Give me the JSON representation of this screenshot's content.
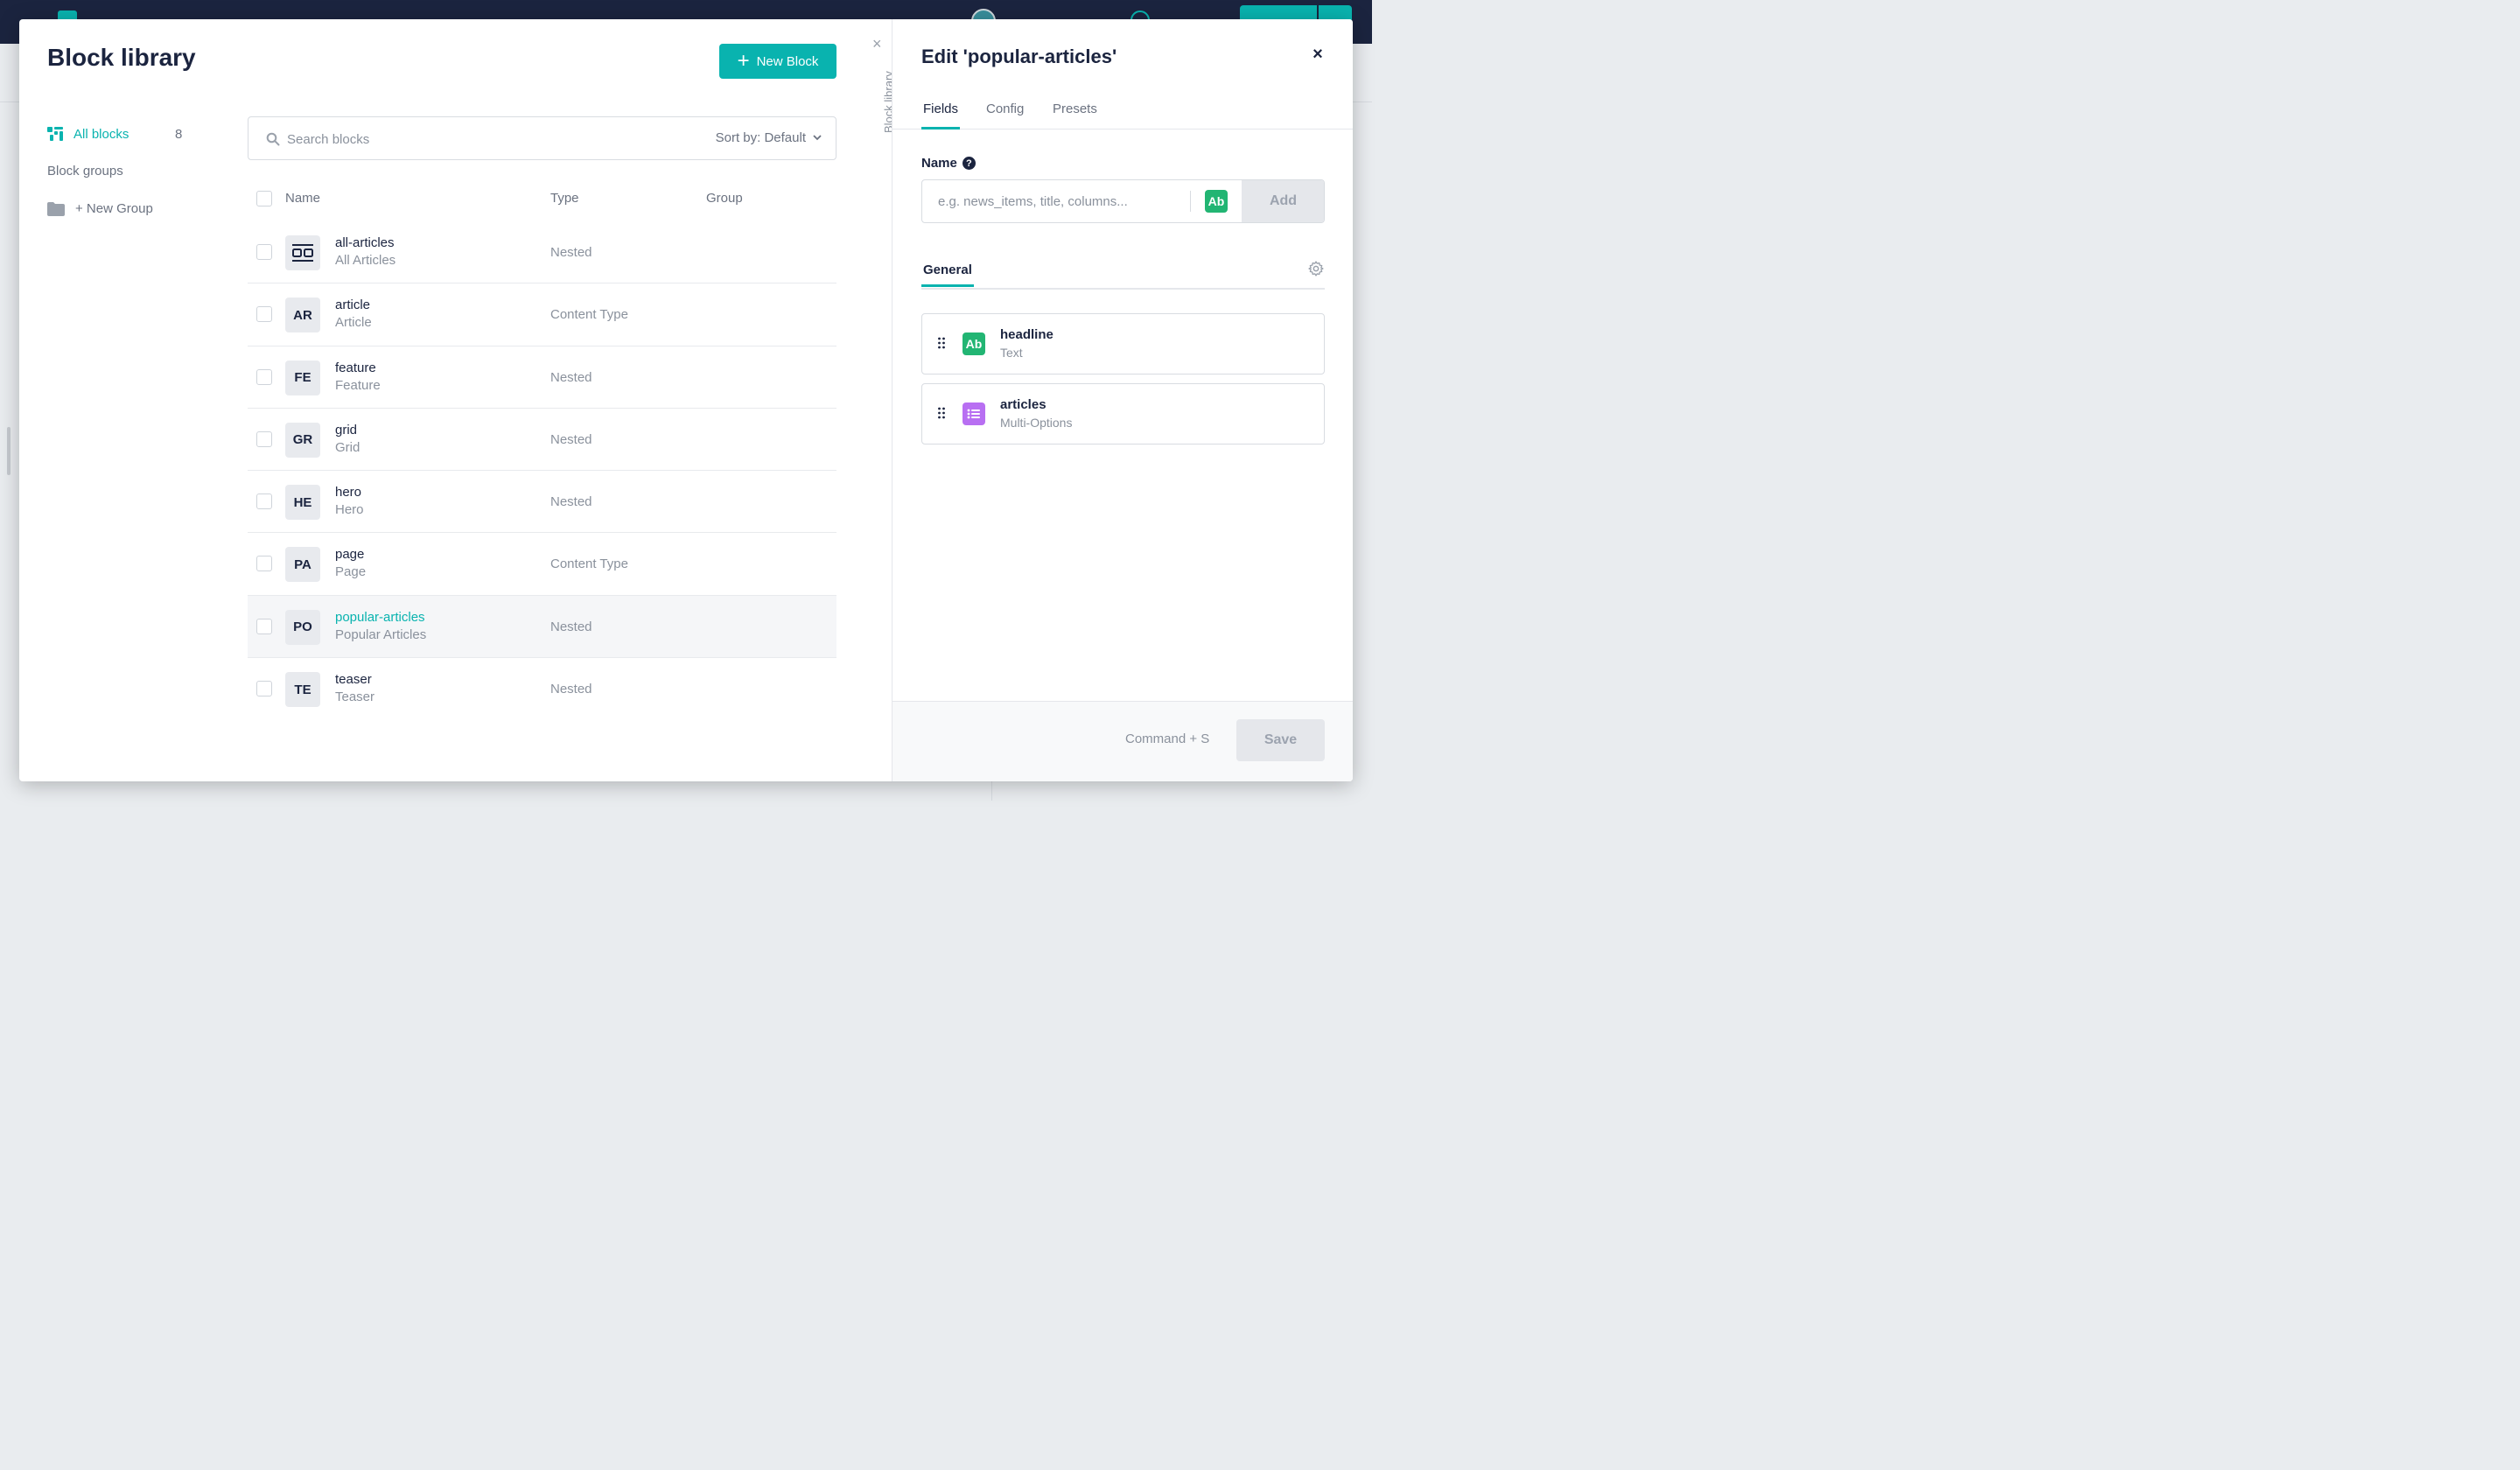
{
  "library": {
    "title": "Block library",
    "new_block_label": "New Block",
    "collapse_label": "Block library",
    "sidebar": {
      "all_blocks_label": "All blocks",
      "all_blocks_count": "8",
      "block_groups_label": "Block groups",
      "new_group_label": "+ New Group"
    },
    "search": {
      "placeholder": "Search blocks",
      "sort_label": "Sort by: Default"
    },
    "columns": {
      "name": "Name",
      "type": "Type",
      "group": "Group"
    },
    "rows": [
      {
        "initials": "",
        "name": "all-articles",
        "display": "All Articles",
        "type": "Nested",
        "selected": false
      },
      {
        "initials": "AR",
        "name": "article",
        "display": "Article",
        "type": "Content Type",
        "selected": false
      },
      {
        "initials": "FE",
        "name": "feature",
        "display": "Feature",
        "type": "Nested",
        "selected": false
      },
      {
        "initials": "GR",
        "name": "grid",
        "display": "Grid",
        "type": "Nested",
        "selected": false
      },
      {
        "initials": "HE",
        "name": "hero",
        "display": "Hero",
        "type": "Nested",
        "selected": false
      },
      {
        "initials": "PA",
        "name": "page",
        "display": "Page",
        "type": "Content Type",
        "selected": false
      },
      {
        "initials": "PO",
        "name": "popular-articles",
        "display": "Popular Articles",
        "type": "Nested",
        "selected": true
      },
      {
        "initials": "TE",
        "name": "teaser",
        "display": "Teaser",
        "type": "Nested",
        "selected": false
      }
    ]
  },
  "editor": {
    "title": "Edit 'popular-articles'",
    "close_icon": "×",
    "tabs": [
      {
        "label": "Fields",
        "active": true
      },
      {
        "label": "Config",
        "active": false
      },
      {
        "label": "Presets",
        "active": false
      }
    ],
    "name_label": "Name",
    "name_placeholder": "e.g. news_items, title, columns...",
    "type_badge": "Ab",
    "add_label": "Add",
    "general_tab_label": "General",
    "fields": [
      {
        "name": "headline",
        "type": "Text",
        "badge": "Ab",
        "badge_color": "#22b573"
      },
      {
        "name": "articles",
        "type": "Multi-Options",
        "badge": "",
        "badge_color": "#b86ff2"
      }
    ],
    "footer": {
      "shortcut": "Command + S",
      "save_label": "Save"
    }
  },
  "colors": {
    "accent": "#09b3af",
    "navy": "#1b243f",
    "text_badge": "#22b573",
    "multi_badge": "#b86ff2"
  }
}
